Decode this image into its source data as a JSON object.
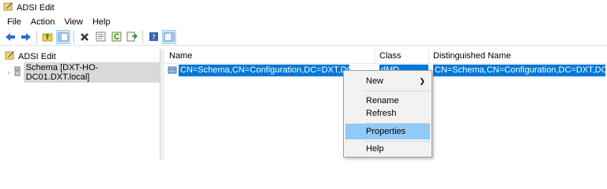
{
  "window": {
    "title": "ADSI Edit"
  },
  "menubar": [
    "File",
    "Action",
    "View",
    "Help"
  ],
  "tree": {
    "root": "ADSI Edit",
    "child": "Schema [DXT-HO-DC01.DXT.local]"
  },
  "list": {
    "columns": [
      "Name",
      "Class",
      "Distinguished Name"
    ],
    "rows": [
      {
        "name": "CN=Schema,CN=Configuration,DC=DXT,DC=local",
        "class": "dMD",
        "dn": "CN=Schema,CN=Configuration,DC=DXT,DC=local"
      }
    ]
  },
  "context_menu": {
    "items": [
      "New",
      "Rename",
      "Refresh",
      "Properties",
      "Help"
    ],
    "hovered": "Properties"
  },
  "colors": {
    "selection": "#0078d7",
    "menu_hover": "#91c9f7"
  }
}
